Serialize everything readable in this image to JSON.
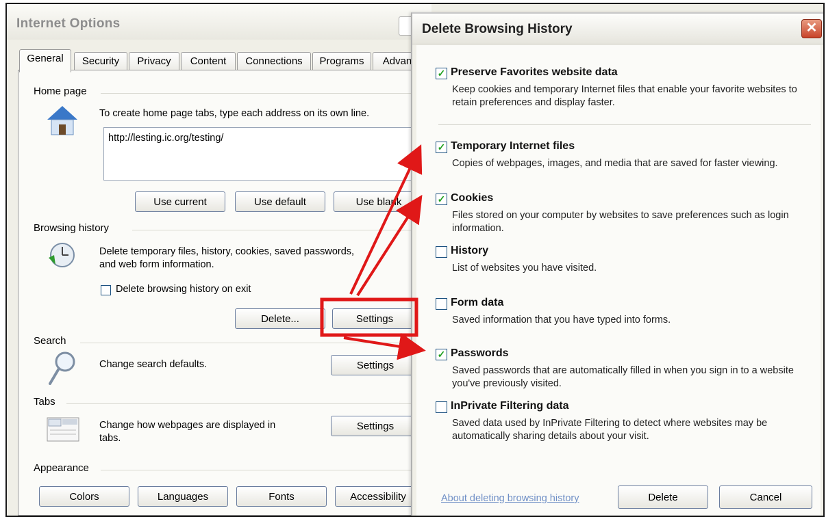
{
  "io": {
    "title": "Internet Options",
    "tabs": [
      "General",
      "Security",
      "Privacy",
      "Content",
      "Connections",
      "Programs",
      "Advan"
    ],
    "home": {
      "section": "Home page",
      "instruction": "To create home page tabs, type each address on its own line.",
      "url": "http://lesting.ic.org/testing/",
      "buttons": [
        "Use current",
        "Use default",
        "Use blank"
      ]
    },
    "history": {
      "section": "Browsing history",
      "desc_line1": "Delete temporary files, history, cookies, saved passwords,",
      "desc_line2": "and web form information.",
      "on_exit_label": "Delete browsing history on exit",
      "delete_label": "Delete...",
      "settings_label": "Settings"
    },
    "search": {
      "section": "Search",
      "desc": "Change search defaults.",
      "settings_label": "Settings"
    },
    "tabs_group": {
      "section": "Tabs",
      "desc_line1": "Change how webpages are displayed in",
      "desc_line2": "tabs.",
      "settings_label": "Settings"
    },
    "appearance": {
      "section": "Appearance",
      "buttons": [
        "Colors",
        "Languages",
        "Fonts",
        "Accessibility"
      ]
    }
  },
  "dlg": {
    "title": "Delete Browsing History",
    "options": [
      {
        "label": "Preserve Favorites website data",
        "desc": "Keep cookies and temporary Internet files that enable your favorite websites to retain preferences and display faster.",
        "checked": true
      },
      {
        "label": "Temporary Internet files",
        "desc": "Copies of webpages, images, and media that are saved for faster viewing.",
        "checked": true
      },
      {
        "label": "Cookies",
        "desc": "Files stored on your computer by websites to save preferences such as login information.",
        "checked": true
      },
      {
        "label": "History",
        "desc": "List of websites you have visited.",
        "checked": false
      },
      {
        "label": "Form data",
        "desc": "Saved information that you have typed into forms.",
        "checked": false
      },
      {
        "label": "Passwords",
        "desc": "Saved passwords that are automatically filled in when you sign in to a website you've previously visited.",
        "checked": true
      },
      {
        "label": "InPrivate Filtering data",
        "desc": "Saved data used by InPrivate Filtering to detect where websites may be automatically sharing details about your visit.",
        "checked": false
      }
    ],
    "about_link": "About deleting browsing history",
    "delete_label": "Delete",
    "cancel_label": "Cancel"
  },
  "colors": {
    "annotation": "#e01818",
    "check": "#21a121",
    "link": "#6f8fc6"
  }
}
